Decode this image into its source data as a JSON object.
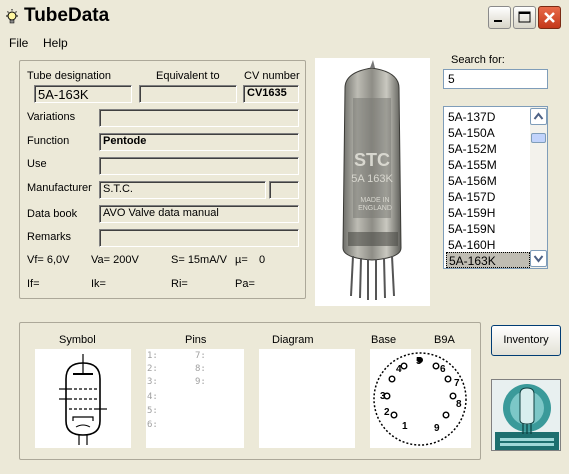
{
  "window": {
    "title": "TubeData"
  },
  "menu": {
    "file": "File",
    "help": "Help"
  },
  "tube": {
    "designation_label": "Tube designation",
    "equivalent_label": "Equivalent to",
    "cv_label": "CV number",
    "designation": "5A-163K",
    "equivalent": "",
    "cv_number": "CV1635",
    "variations_label": "Variations",
    "variations": "",
    "function_label": "Function",
    "function": "Pentode",
    "use_label": "Use",
    "use": "",
    "manufacturer_label": "Manufacturer",
    "manufacturer": "S.T.C.",
    "manufacturer_code": "",
    "databook_label": "Data book",
    "databook": "AVO Valve data manual",
    "remarks_label": "Remarks",
    "remarks": "",
    "vf": "Vf= 6,0V",
    "va": "Va= 200V",
    "s": "S= 15mA/V",
    "mu": "µ=",
    "mu_value": "0",
    "if": "If=",
    "ik": "Ik=",
    "ri": "Ri=",
    "pa": "Pa="
  },
  "photo": {
    "print_line1": "STC",
    "print_line2": "5A 163K",
    "print_line3": "MADE IN",
    "print_line4": "ENGLAND"
  },
  "search": {
    "label": "Search for:",
    "value": "5"
  },
  "tube_list": [
    "5A-137D",
    "5A-150A",
    "5A-152M",
    "5A-155M",
    "5A-156M",
    "5A-157D",
    "5A-159H",
    "5A-159N",
    "5A-160H",
    "5A-163K"
  ],
  "selected_tube": "5A-163K",
  "bottom": {
    "symbol_label": "Symbol",
    "pins_label": "Pins",
    "diagram_label": "Diagram",
    "base_label": "Base",
    "base_type": "B9A",
    "pins_left": [
      "1:",
      "2:",
      "3:",
      "4:",
      "5:",
      "6:"
    ],
    "pins_right": [
      "7:",
      "8:",
      "9:"
    ],
    "base_pin_numbers": [
      "1",
      "2",
      "3",
      "4",
      "5",
      "6",
      "7",
      "8",
      "9"
    ]
  },
  "inventory_label": "Inventory",
  "icons": {
    "app": "lightbulb-icon",
    "minimize": "minimize-icon",
    "maximize": "maximize-icon",
    "close": "close-icon",
    "scroll_up": "arrow-up-icon",
    "scroll_down": "arrow-down-icon"
  },
  "colors": {
    "window_bg": "#ece9d8",
    "close_button": "#c4381a",
    "selection": "#c0bdb3",
    "logo_teal": "#2a8a8a"
  }
}
